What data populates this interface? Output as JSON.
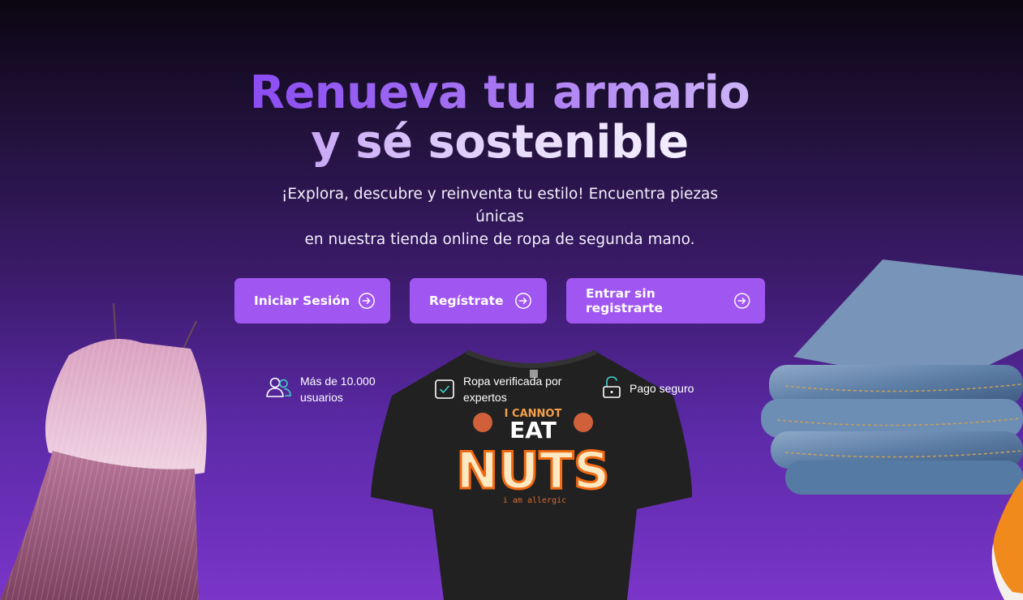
{
  "hero": {
    "title_line1": "Renueva tu armario",
    "title_line2": "y sé sostenible",
    "subtitle_line1": "¡Explora, descubre y reinventa tu estilo! Encuentra piezas únicas",
    "subtitle_line2": "en nuestra tienda online de ropa de segunda mano."
  },
  "buttons": [
    {
      "label": "Iniciar Sesión",
      "icon": "arrow-circle-right-icon"
    },
    {
      "label": "Regístrate",
      "icon": "arrow-circle-right-icon"
    },
    {
      "label": "Entrar sin registrarte",
      "icon": "arrow-circle-right-icon"
    }
  ],
  "features": [
    {
      "line1": "Más de 10.000",
      "line2": "usuarios",
      "icon": "users-icon"
    },
    {
      "line1": "Ropa verificada por",
      "line2": "expertos",
      "icon": "check-square-icon"
    },
    {
      "line1": "Pago seguro",
      "line2": "",
      "icon": "unlock-icon"
    }
  ],
  "tshirt": {
    "top_text": "I CANNOT",
    "mid_text": "EAT",
    "big_text": "NUTS",
    "small_text": "i am allergic"
  },
  "colors": {
    "accent": "#a056f1",
    "feature_icon_teal": "#3fd0c9"
  }
}
